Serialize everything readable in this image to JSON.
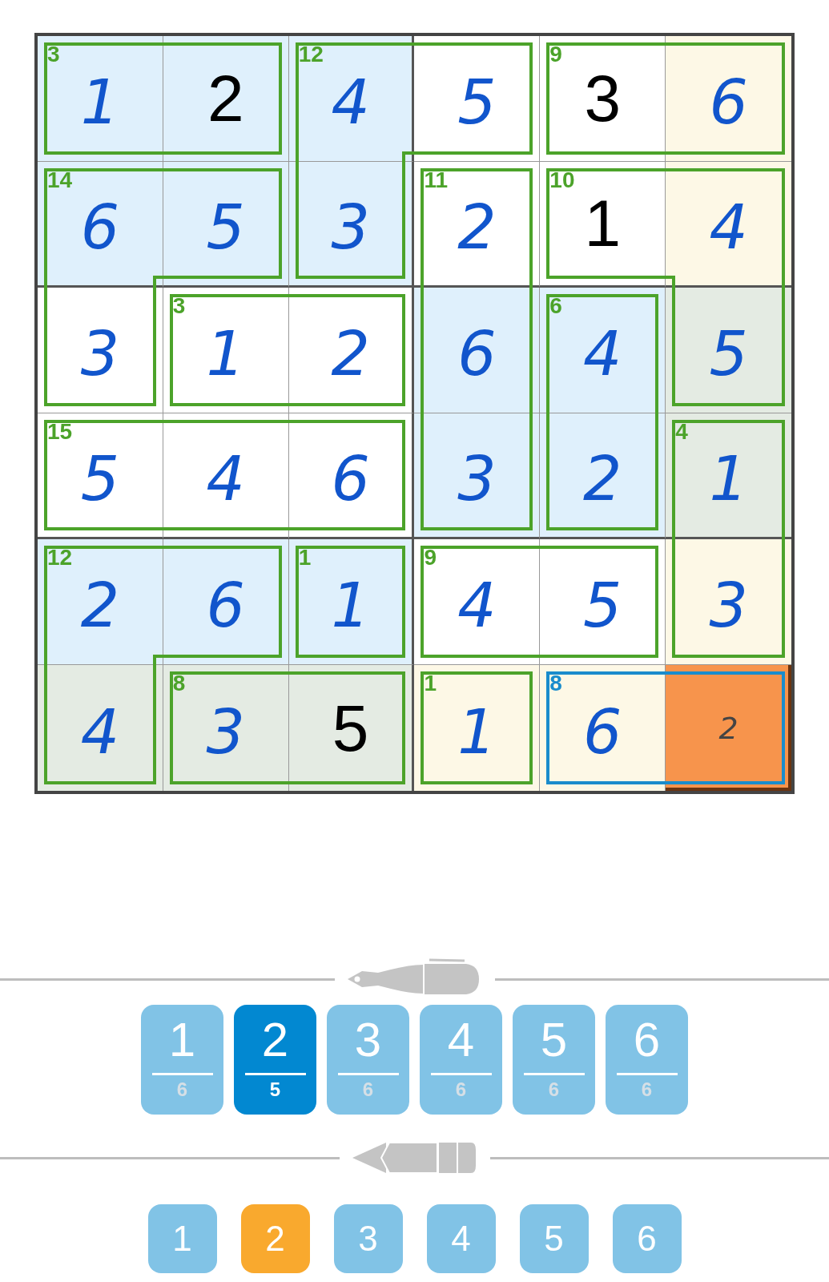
{
  "grid": {
    "rows": [
      [
        {
          "value": "1",
          "kind": "entry",
          "color": "#dff0fc",
          "cage_sum": "3",
          "join_right": true,
          "join_down": false,
          "cage_selected": false,
          "selected": false
        },
        {
          "value": "2",
          "kind": "given",
          "color": "#dff0fc",
          "join_right": false,
          "join_down": false,
          "cage_selected": false,
          "selected": false
        },
        {
          "value": "4",
          "kind": "entry",
          "color": "#dff0fc",
          "cage_sum": "12",
          "join_right": true,
          "join_down": true,
          "cage_selected": false,
          "selected": false
        },
        {
          "value": "5",
          "kind": "entry",
          "color": "#ffffff",
          "join_right": false,
          "join_down": false,
          "cage_selected": false,
          "selected": false
        },
        {
          "value": "3",
          "kind": "given",
          "color": "#ffffff",
          "cage_sum": "9",
          "join_right": true,
          "join_down": false,
          "cage_selected": false,
          "selected": false
        },
        {
          "value": "6",
          "kind": "entry",
          "color": "#fdf8e6",
          "join_right": false,
          "join_down": false,
          "cage_selected": false,
          "selected": false
        }
      ],
      [
        {
          "value": "6",
          "kind": "entry",
          "color": "#dff0fc",
          "cage_sum": "14",
          "join_right": true,
          "join_down": true,
          "cage_selected": false,
          "selected": false
        },
        {
          "value": "5",
          "kind": "entry",
          "color": "#dff0fc",
          "join_right": false,
          "join_down": false,
          "cage_selected": false,
          "selected": false
        },
        {
          "value": "3",
          "kind": "entry",
          "color": "#dff0fc",
          "join_right": false,
          "join_down": false,
          "cage_selected": false,
          "selected": false
        },
        {
          "value": "2",
          "kind": "entry",
          "color": "#ffffff",
          "cage_sum": "11",
          "join_right": false,
          "join_down": true,
          "cage_selected": false,
          "selected": false
        },
        {
          "value": "1",
          "kind": "given",
          "color": "#ffffff",
          "cage_sum": "10",
          "join_right": true,
          "join_down": false,
          "cage_selected": false,
          "selected": false
        },
        {
          "value": "4",
          "kind": "entry",
          "color": "#fdf8e6",
          "join_right": false,
          "join_down": true,
          "cage_selected": false,
          "selected": false
        }
      ],
      [
        {
          "value": "3",
          "kind": "entry",
          "color": "#ffffff",
          "join_right": false,
          "join_down": false,
          "cage_selected": false,
          "selected": false
        },
        {
          "value": "1",
          "kind": "entry",
          "color": "#ffffff",
          "cage_sum": "3",
          "join_right": true,
          "join_down": false,
          "cage_selected": false,
          "selected": false
        },
        {
          "value": "2",
          "kind": "entry",
          "color": "#ffffff",
          "join_right": false,
          "join_down": false,
          "cage_selected": false,
          "selected": false
        },
        {
          "value": "6",
          "kind": "entry",
          "color": "#dff0fc",
          "join_right": false,
          "join_down": true,
          "cage_selected": false,
          "selected": false
        },
        {
          "value": "4",
          "kind": "entry",
          "color": "#dff0fc",
          "cage_sum": "6",
          "join_right": false,
          "join_down": true,
          "cage_selected": false,
          "selected": false
        },
        {
          "value": "5",
          "kind": "entry",
          "color": "#e4ebe3",
          "join_right": false,
          "join_down": false,
          "cage_selected": false,
          "selected": false
        }
      ],
      [
        {
          "value": "5",
          "kind": "entry",
          "color": "#ffffff",
          "cage_sum": "15",
          "join_right": true,
          "join_down": false,
          "cage_selected": false,
          "selected": false
        },
        {
          "value": "4",
          "kind": "entry",
          "color": "#ffffff",
          "join_right": true,
          "join_down": false,
          "cage_selected": false,
          "selected": false
        },
        {
          "value": "6",
          "kind": "entry",
          "color": "#ffffff",
          "join_right": false,
          "join_down": false,
          "cage_selected": false,
          "selected": false
        },
        {
          "value": "3",
          "kind": "entry",
          "color": "#dff0fc",
          "join_right": false,
          "join_down": false,
          "cage_selected": false,
          "selected": false
        },
        {
          "value": "2",
          "kind": "entry",
          "color": "#dff0fc",
          "join_right": false,
          "join_down": false,
          "cage_selected": false,
          "selected": false
        },
        {
          "value": "1",
          "kind": "entry",
          "color": "#e4ebe3",
          "cage_sum": "4",
          "join_right": false,
          "join_down": true,
          "cage_selected": false,
          "selected": false
        }
      ],
      [
        {
          "value": "2",
          "kind": "entry",
          "color": "#dff0fc",
          "cage_sum": "12",
          "join_right": true,
          "join_down": true,
          "cage_selected": false,
          "selected": false
        },
        {
          "value": "6",
          "kind": "entry",
          "color": "#dff0fc",
          "join_right": false,
          "join_down": false,
          "cage_selected": false,
          "selected": false
        },
        {
          "value": "1",
          "kind": "entry",
          "color": "#dff0fc",
          "cage_sum": "1",
          "join_right": false,
          "join_down": false,
          "cage_selected": false,
          "selected": false
        },
        {
          "value": "4",
          "kind": "entry",
          "color": "#ffffff",
          "cage_sum": "9",
          "join_right": true,
          "join_down": false,
          "cage_selected": false,
          "selected": false
        },
        {
          "value": "5",
          "kind": "entry",
          "color": "#ffffff",
          "join_right": false,
          "join_down": false,
          "cage_selected": false,
          "selected": false
        },
        {
          "value": "3",
          "kind": "entry",
          "color": "#fdf8e6",
          "join_right": false,
          "join_down": false,
          "cage_selected": false,
          "selected": false
        }
      ],
      [
        {
          "value": "4",
          "kind": "entry",
          "color": "#e4ebe3",
          "join_right": false,
          "join_down": false,
          "cage_selected": false,
          "selected": false
        },
        {
          "value": "3",
          "kind": "entry",
          "color": "#e4ebe3",
          "cage_sum": "8",
          "join_right": true,
          "join_down": false,
          "cage_selected": false,
          "selected": false
        },
        {
          "value": "5",
          "kind": "given",
          "color": "#e4ebe3",
          "join_right": false,
          "join_down": false,
          "cage_selected": false,
          "selected": false
        },
        {
          "value": "1",
          "kind": "entry",
          "color": "#fdf8e6",
          "cage_sum": "1",
          "join_right": false,
          "join_down": false,
          "cage_selected": false,
          "selected": false
        },
        {
          "value": "6",
          "kind": "entry",
          "color": "#fdf8e6",
          "cage_sum": "8",
          "join_right": true,
          "join_down": false,
          "cage_selected": true,
          "selected": false
        },
        {
          "value": "2",
          "kind": "pencil",
          "color": "#f7944c",
          "join_right": false,
          "join_down": false,
          "cage_selected": true,
          "selected": true
        }
      ]
    ]
  },
  "pen_buttons": [
    {
      "digit": "1",
      "count": "6",
      "selected": false
    },
    {
      "digit": "2",
      "count": "5",
      "selected": true
    },
    {
      "digit": "3",
      "count": "6",
      "selected": false
    },
    {
      "digit": "4",
      "count": "6",
      "selected": false
    },
    {
      "digit": "5",
      "count": "6",
      "selected": false
    },
    {
      "digit": "6",
      "count": "6",
      "selected": false
    }
  ],
  "pencil_buttons": [
    {
      "digit": "1",
      "selected": false
    },
    {
      "digit": "2",
      "selected": true
    },
    {
      "digit": "3",
      "selected": false
    },
    {
      "digit": "4",
      "selected": false
    },
    {
      "digit": "5",
      "selected": false
    },
    {
      "digit": "6",
      "selected": false
    }
  ]
}
